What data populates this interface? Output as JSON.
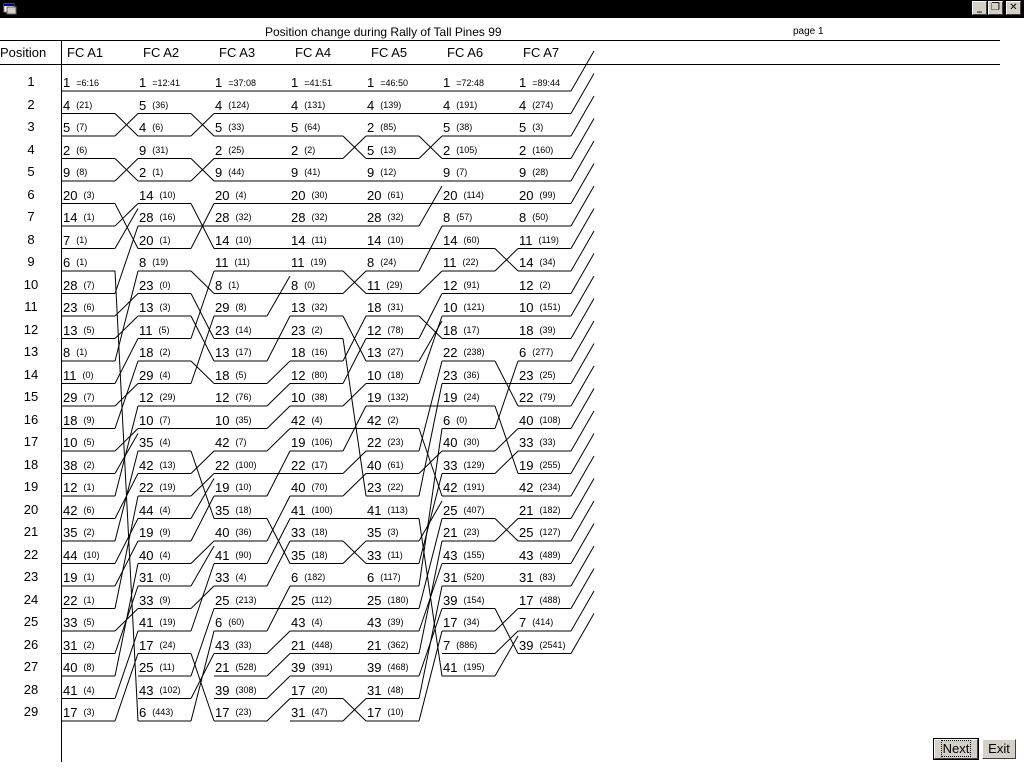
{
  "window": {
    "minimize_glyph": "_",
    "restore_glyph": "❐",
    "close_glyph": "✕"
  },
  "report": {
    "title": "Position change during Rally of Tall Pines 99",
    "page_label": "page 1"
  },
  "header": {
    "position_label": "Position",
    "stages": [
      "FC A1",
      "FC A2",
      "FC A3",
      "FC A4",
      "FC A5",
      "FC A6",
      "FC A7"
    ]
  },
  "positions": [
    1,
    2,
    3,
    4,
    5,
    6,
    7,
    8,
    9,
    10,
    11,
    12,
    13,
    14,
    15,
    16,
    17,
    18,
    19,
    20,
    21,
    22,
    23,
    24,
    25,
    26,
    27,
    28,
    29
  ],
  "standings": [
    [
      [
        "1",
        "=6:16"
      ],
      [
        "4",
        "(21)"
      ],
      [
        "5",
        "(7)"
      ],
      [
        "2",
        "(6)"
      ],
      [
        "9",
        "(8)"
      ],
      [
        "20",
        "(3)"
      ],
      [
        "14",
        "(1)"
      ],
      [
        "7",
        "(1)"
      ],
      [
        "6",
        "(1)"
      ],
      [
        "28",
        "(7)"
      ],
      [
        "23",
        "(6)"
      ],
      [
        "13",
        "(5)"
      ],
      [
        "8",
        "(1)"
      ],
      [
        "11",
        "(0)"
      ],
      [
        "29",
        "(7)"
      ],
      [
        "18",
        "(9)"
      ],
      [
        "10",
        "(5)"
      ],
      [
        "38",
        "(2)"
      ],
      [
        "12",
        "(1)"
      ],
      [
        "42",
        "(6)"
      ],
      [
        "35",
        "(2)"
      ],
      [
        "44",
        "(10)"
      ],
      [
        "19",
        "(1)"
      ],
      [
        "22",
        "(1)"
      ],
      [
        "33",
        "(5)"
      ],
      [
        "31",
        "(2)"
      ],
      [
        "40",
        "(8)"
      ],
      [
        "41",
        "(4)"
      ],
      [
        "17",
        "(3)"
      ]
    ],
    [
      [
        "1",
        "=12:41"
      ],
      [
        "5",
        "(36)"
      ],
      [
        "4",
        "(6)"
      ],
      [
        "9",
        "(31)"
      ],
      [
        "2",
        "(1)"
      ],
      [
        "14",
        "(10)"
      ],
      [
        "28",
        "(16)"
      ],
      [
        "20",
        "(1)"
      ],
      [
        "8",
        "(19)"
      ],
      [
        "23",
        "(0)"
      ],
      [
        "13",
        "(3)"
      ],
      [
        "11",
        "(5)"
      ],
      [
        "18",
        "(2)"
      ],
      [
        "29",
        "(4)"
      ],
      [
        "12",
        "(29)"
      ],
      [
        "10",
        "(7)"
      ],
      [
        "35",
        "(4)"
      ],
      [
        "42",
        "(13)"
      ],
      [
        "22",
        "(19)"
      ],
      [
        "44",
        "(4)"
      ],
      [
        "19",
        "(9)"
      ],
      [
        "40",
        "(4)"
      ],
      [
        "31",
        "(0)"
      ],
      [
        "33",
        "(9)"
      ],
      [
        "41",
        "(19)"
      ],
      [
        "17",
        "(24)"
      ],
      [
        "25",
        "(11)"
      ],
      [
        "43",
        "(102)"
      ],
      [
        "6",
        "(443)"
      ]
    ],
    [
      [
        "1",
        "=37:08"
      ],
      [
        "4",
        "(124)"
      ],
      [
        "5",
        "(33)"
      ],
      [
        "2",
        "(25)"
      ],
      [
        "9",
        "(44)"
      ],
      [
        "20",
        "(4)"
      ],
      [
        "28",
        "(32)"
      ],
      [
        "14",
        "(10)"
      ],
      [
        "11",
        "(11)"
      ],
      [
        "8",
        "(1)"
      ],
      [
        "29",
        "(8)"
      ],
      [
        "23",
        "(14)"
      ],
      [
        "13",
        "(17)"
      ],
      [
        "18",
        "(5)"
      ],
      [
        "12",
        "(76)"
      ],
      [
        "10",
        "(35)"
      ],
      [
        "42",
        "(7)"
      ],
      [
        "22",
        "(100)"
      ],
      [
        "19",
        "(10)"
      ],
      [
        "35",
        "(18)"
      ],
      [
        "40",
        "(36)"
      ],
      [
        "41",
        "(90)"
      ],
      [
        "33",
        "(4)"
      ],
      [
        "25",
        "(213)"
      ],
      [
        "6",
        "(60)"
      ],
      [
        "43",
        "(33)"
      ],
      [
        "21",
        "(528)"
      ],
      [
        "39",
        "(308)"
      ],
      [
        "17",
        "(23)"
      ]
    ],
    [
      [
        "1",
        "=41:51"
      ],
      [
        "4",
        "(131)"
      ],
      [
        "5",
        "(64)"
      ],
      [
        "2",
        "(2)"
      ],
      [
        "9",
        "(41)"
      ],
      [
        "20",
        "(30)"
      ],
      [
        "28",
        "(32)"
      ],
      [
        "14",
        "(11)"
      ],
      [
        "11",
        "(19)"
      ],
      [
        "8",
        "(0)"
      ],
      [
        "13",
        "(32)"
      ],
      [
        "23",
        "(2)"
      ],
      [
        "18",
        "(16)"
      ],
      [
        "12",
        "(80)"
      ],
      [
        "10",
        "(38)"
      ],
      [
        "42",
        "(4)"
      ],
      [
        "19",
        "(106)"
      ],
      [
        "22",
        "(17)"
      ],
      [
        "40",
        "(70)"
      ],
      [
        "41",
        "(100)"
      ],
      [
        "33",
        "(18)"
      ],
      [
        "35",
        "(18)"
      ],
      [
        "6",
        "(182)"
      ],
      [
        "25",
        "(112)"
      ],
      [
        "43",
        "(4)"
      ],
      [
        "21",
        "(448)"
      ],
      [
        "39",
        "(391)"
      ],
      [
        "17",
        "(20)"
      ],
      [
        "31",
        "(47)"
      ]
    ],
    [
      [
        "1",
        "=46:50"
      ],
      [
        "4",
        "(139)"
      ],
      [
        "2",
        "(85)"
      ],
      [
        "5",
        "(13)"
      ],
      [
        "9",
        "(12)"
      ],
      [
        "20",
        "(61)"
      ],
      [
        "28",
        "(32)"
      ],
      [
        "14",
        "(10)"
      ],
      [
        "8",
        "(24)"
      ],
      [
        "11",
        "(29)"
      ],
      [
        "18",
        "(31)"
      ],
      [
        "12",
        "(78)"
      ],
      [
        "13",
        "(27)"
      ],
      [
        "10",
        "(18)"
      ],
      [
        "19",
        "(132)"
      ],
      [
        "42",
        "(2)"
      ],
      [
        "22",
        "(23)"
      ],
      [
        "40",
        "(61)"
      ],
      [
        "23",
        "(22)"
      ],
      [
        "41",
        "(113)"
      ],
      [
        "35",
        "(3)"
      ],
      [
        "33",
        "(11)"
      ],
      [
        "6",
        "(117)"
      ],
      [
        "25",
        "(180)"
      ],
      [
        "43",
        "(39)"
      ],
      [
        "21",
        "(362)"
      ],
      [
        "39",
        "(468)"
      ],
      [
        "31",
        "(48)"
      ],
      [
        "17",
        "(10)"
      ]
    ],
    [
      [
        "1",
        "=72:48"
      ],
      [
        "4",
        "(191)"
      ],
      [
        "5",
        "(38)"
      ],
      [
        "2",
        "(105)"
      ],
      [
        "9",
        "(7)"
      ],
      [
        "20",
        "(114)"
      ],
      [
        "8",
        "(57)"
      ],
      [
        "14",
        "(60)"
      ],
      [
        "11",
        "(22)"
      ],
      [
        "12",
        "(91)"
      ],
      [
        "10",
        "(121)"
      ],
      [
        "18",
        "(17)"
      ],
      [
        "22",
        "(238)"
      ],
      [
        "23",
        "(36)"
      ],
      [
        "19",
        "(24)"
      ],
      [
        "6",
        "(0)"
      ],
      [
        "40",
        "(30)"
      ],
      [
        "33",
        "(129)"
      ],
      [
        "42",
        "(191)"
      ],
      [
        "25",
        "(407)"
      ],
      [
        "21",
        "(23)"
      ],
      [
        "43",
        "(155)"
      ],
      [
        "31",
        "(520)"
      ],
      [
        "39",
        "(154)"
      ],
      [
        "17",
        "(34)"
      ],
      [
        "7",
        "(886)"
      ],
      [
        "41",
        "(195)"
      ]
    ],
    [
      [
        "1",
        "=89:44"
      ],
      [
        "4",
        "(274)"
      ],
      [
        "5",
        "(3)"
      ],
      [
        "2",
        "(160)"
      ],
      [
        "9",
        "(28)"
      ],
      [
        "20",
        "(99)"
      ],
      [
        "8",
        "(50)"
      ],
      [
        "11",
        "(119)"
      ],
      [
        "14",
        "(34)"
      ],
      [
        "12",
        "(2)"
      ],
      [
        "10",
        "(151)"
      ],
      [
        "18",
        "(39)"
      ],
      [
        "6",
        "(277)"
      ],
      [
        "23",
        "(25)"
      ],
      [
        "22",
        "(79)"
      ],
      [
        "40",
        "(108)"
      ],
      [
        "33",
        "(33)"
      ],
      [
        "19",
        "(255)"
      ],
      [
        "42",
        "(234)"
      ],
      [
        "21",
        "(182)"
      ],
      [
        "25",
        "(127)"
      ],
      [
        "43",
        "(489)"
      ],
      [
        "31",
        "(83)"
      ],
      [
        "17",
        "(488)"
      ],
      [
        "7",
        "(414)"
      ],
      [
        "39",
        "(2541)"
      ]
    ]
  ],
  "buttons": {
    "next_label": "Next",
    "exit_label": "Exit"
  }
}
